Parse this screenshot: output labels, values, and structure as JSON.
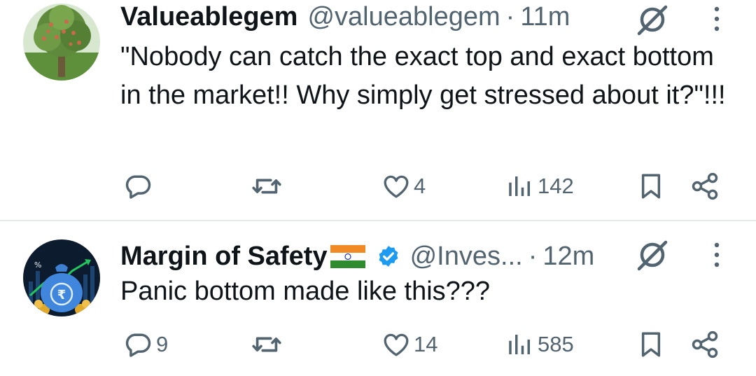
{
  "tweets": [
    {
      "author": "Valueablegem",
      "handle": "@valueablegem",
      "separator": "·",
      "time": "11m",
      "text": "\"Nobody can catch the exact top and exact bottom in the market!! Why simply get stressed about it?\"!!!",
      "replies": "",
      "retweets": "",
      "likes": "4",
      "views": "142",
      "icons": [
        "tree-avatar",
        "grok-icon",
        "more-icon",
        "reply-icon",
        "retweet-icon",
        "like-icon",
        "views-icon",
        "bookmark-icon",
        "share-icon"
      ]
    },
    {
      "author": "Margin of Safety",
      "handle": "@Inves...",
      "separator": "·",
      "time": "12m",
      "text": "Panic bottom made like this???",
      "replies": "9",
      "retweets": "",
      "likes": "14",
      "views": "585",
      "icons": [
        "money-bag-avatar",
        "india-flag",
        "verified-badge",
        "grok-icon",
        "more-icon",
        "reply-icon",
        "retweet-icon",
        "like-icon",
        "views-icon",
        "bookmark-icon",
        "share-icon"
      ]
    }
  ],
  "colors": {
    "text": "#0f1419",
    "secondary": "#536471",
    "verified": "#1d9bf0",
    "divider": "#e6e9eb"
  }
}
